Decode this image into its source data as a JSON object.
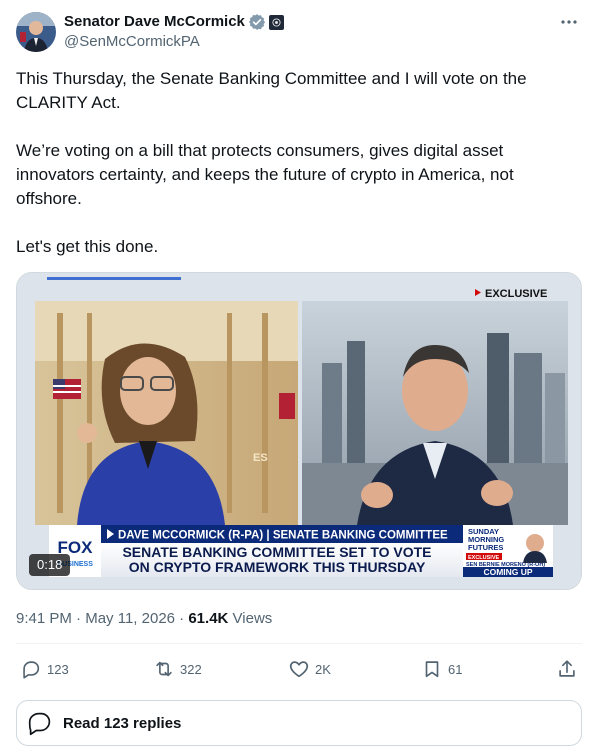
{
  "author": {
    "display_name": "Senator Dave McCormick",
    "handle": "@SenMcCormickPA",
    "verified_badge_icon": "verified-badge-icon",
    "affiliation_icon": "senate-seal-icon"
  },
  "tweet": {
    "paragraphs": [
      "This Thursday, the Senate Banking Committee and I will vote on the CLARITY Act.",
      "We’re voting on a bill that protects consumers, gives digital asset innovators certainty, and keeps the future of crypto in America, not offshore.",
      "Let's get this done."
    ]
  },
  "video": {
    "duration": "0:18",
    "exclusive_tag": "EXCLUSIVE",
    "network_logo": "FOX",
    "network_sub": "BUSINESS",
    "lower_third_top": "DAVE MCCORMICK (R-PA) | SENATE BANKING COMMITTEE",
    "headline_line1": "SENATE BANKING COMMITTEE SET TO VOTE",
    "headline_line2": "ON CRYPTO FRAMEWORK THIS THURSDAY",
    "promo_show_line1": "SUNDAY",
    "promo_show_line2": "MORNING",
    "promo_show_line3": "FUTURES",
    "promo_exclusive": "EXCLUSIVE",
    "promo_guest": "SEN BERNIE MORENO (R-OH)",
    "promo_coming_up": "COMING UP",
    "backdrop_text": "ES"
  },
  "meta": {
    "time": "9:41 PM",
    "separator": "·",
    "date": "May 11, 2026",
    "views_count": "61.4K",
    "views_label": "Views"
  },
  "actions": {
    "reply_count": "123",
    "repost_count": "322",
    "like_count": "2K",
    "bookmark_count": "61"
  },
  "replies_button": {
    "label": "Read 123 replies"
  },
  "colors": {
    "text_primary": "#0f1419",
    "text_secondary": "#536471",
    "verified_blue": "#1d9bf0",
    "border": "#cfd9de",
    "fox_blue": "#0b2a7a"
  }
}
